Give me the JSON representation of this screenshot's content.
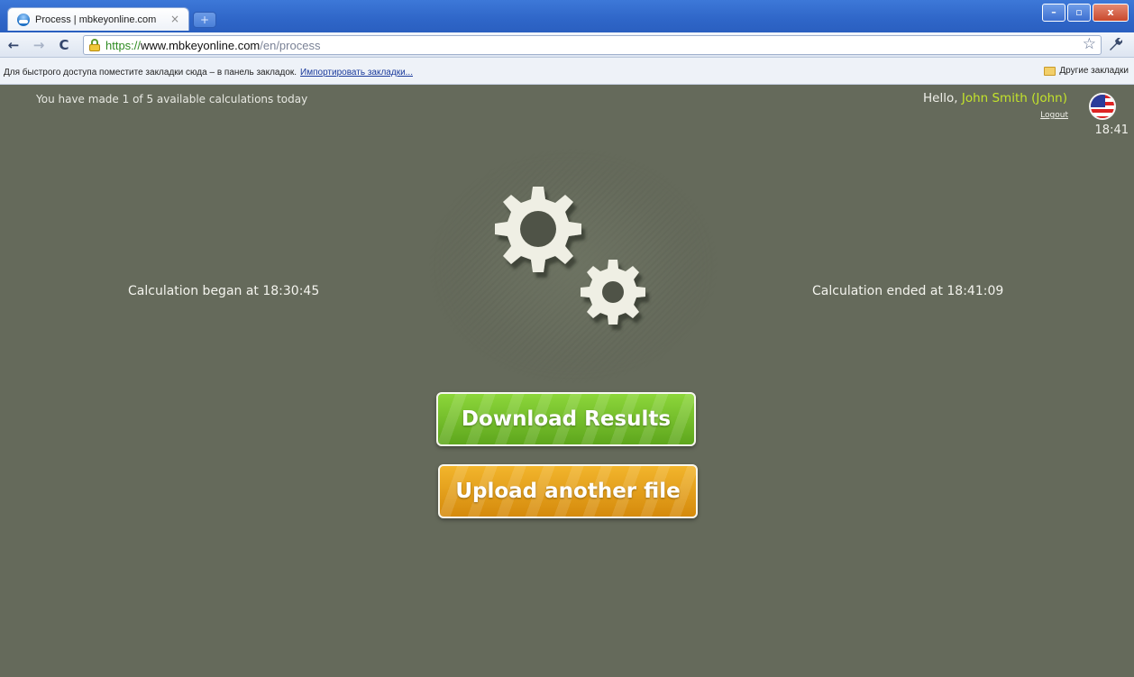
{
  "browser": {
    "tab_title": "Process | mbkeyonline.com",
    "tab_close": "×",
    "new_tab": "+",
    "url_scheme": "https://",
    "url_host": "www.mbkeyonline.com",
    "url_path": "/en/process",
    "window_buttons": {
      "minimize": "–",
      "maximize": "▫",
      "close": "x"
    },
    "bookmarks_hint": "Для быстрого доступа поместите закладки сюда – в панель закладок.",
    "bookmarks_import": "Импортировать закладки...",
    "other_bookmarks": "Другие закладки",
    "icons": [
      "back-arrow-icon",
      "forward-arrow-icon",
      "reload-icon",
      "lock-icon",
      "star-icon",
      "wrench-icon",
      "folder-icon"
    ]
  },
  "page": {
    "usage_text": "You have made 1 of 5 available calculations today",
    "greeting_prefix": "Hello, ",
    "user_name": "John Smith (John)",
    "logout": "Logout",
    "clock": "18:41",
    "calc_began": "Calculation began at 18:30:45",
    "calc_ended": "Calculation ended at 18:41:09",
    "download_button": "Download Results",
    "upload_button": "Upload another file",
    "colors": {
      "background": "#656a5b",
      "user_name": "#c3e32b",
      "download_button": "#7cc52e",
      "upload_button": "#e9a21c"
    }
  }
}
